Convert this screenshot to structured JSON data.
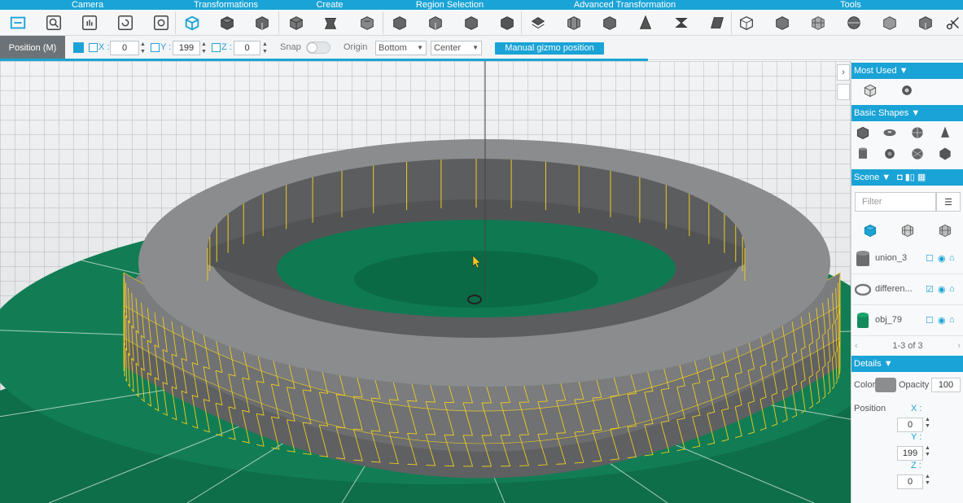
{
  "toolbar": {
    "groups": [
      "Camera",
      "Transformations",
      "Create",
      "Region Selection",
      "Advanced Transformation",
      "Tools"
    ]
  },
  "posbar": {
    "mode_label": "Position (M)",
    "x_label": "X :",
    "x_value": "0",
    "y_label": "Y :",
    "y_value": "199",
    "z_label": "Z :",
    "z_value": "0",
    "snap_label": "Snap",
    "origin_label": "Origin",
    "origin_vertical": "Bottom",
    "origin_horizontal": "Center",
    "gizmo_button": "Manual gizmo position"
  },
  "panel": {
    "most_used": "Most Used",
    "basic_shapes": "Basic Shapes",
    "scene": "Scene",
    "filter_placeholder": "Filter",
    "objects": [
      {
        "name": "union_3",
        "visible_checked": false
      },
      {
        "name": "differen...",
        "visible_checked": true
      },
      {
        "name": "obj_79",
        "visible_checked": false
      }
    ],
    "pager": "1-3 of 3",
    "details": "Details",
    "color_label": "Color",
    "opacity_label": "Opacity",
    "opacity_value": "100",
    "position_label": "Position",
    "x_label": "X :",
    "x_value": "0",
    "y_label": "Y :",
    "y_value": "199",
    "z_label": "Z :",
    "z_value": "0"
  },
  "colors": {
    "accent": "#1aa3d6",
    "ground": "#0f7a52",
    "ring": "#77797b",
    "wire": "#f0cc1e"
  }
}
